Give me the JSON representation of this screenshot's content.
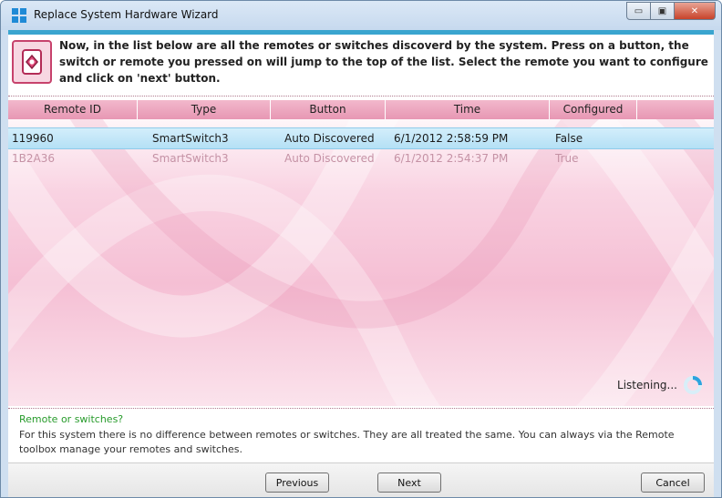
{
  "window": {
    "title": "Replace System Hardware Wizard",
    "minimize_glyph": "▭",
    "maximize_glyph": "▣",
    "close_glyph": "✕",
    "accent_color": "#3aa5cf"
  },
  "header": {
    "icon": "remote-device-icon",
    "instruction": "Now, in the list below are all the remotes or switches discoverd by the system. Press on a button, the switch or remote you pressed on will jump to the top of the list. Select the remote you want to configure and click on 'next' button."
  },
  "list": {
    "columns": [
      "Remote ID",
      "Type",
      "Button",
      "Time",
      "Configured"
    ],
    "rows": [
      {
        "remote_id": "119960",
        "type": "SmartSwitch3",
        "button": "Auto Discovered",
        "time": "6/1/2012 2:58:59 PM",
        "configured": "False",
        "selected": true
      },
      {
        "remote_id": "1B2A36",
        "type": "SmartSwitch3",
        "button": "Auto Discovered",
        "time": "6/1/2012 2:54:37 PM",
        "configured": "True",
        "selected": false
      }
    ],
    "status": "Listening..."
  },
  "info": {
    "title": "Remote or switches?",
    "body": "For this system there is no difference between remotes or switches. They are all treated the same. You can always via the Remote toolbox manage your remotes and switches."
  },
  "buttons": {
    "previous": "Previous",
    "next": "Next",
    "cancel": "Cancel"
  }
}
